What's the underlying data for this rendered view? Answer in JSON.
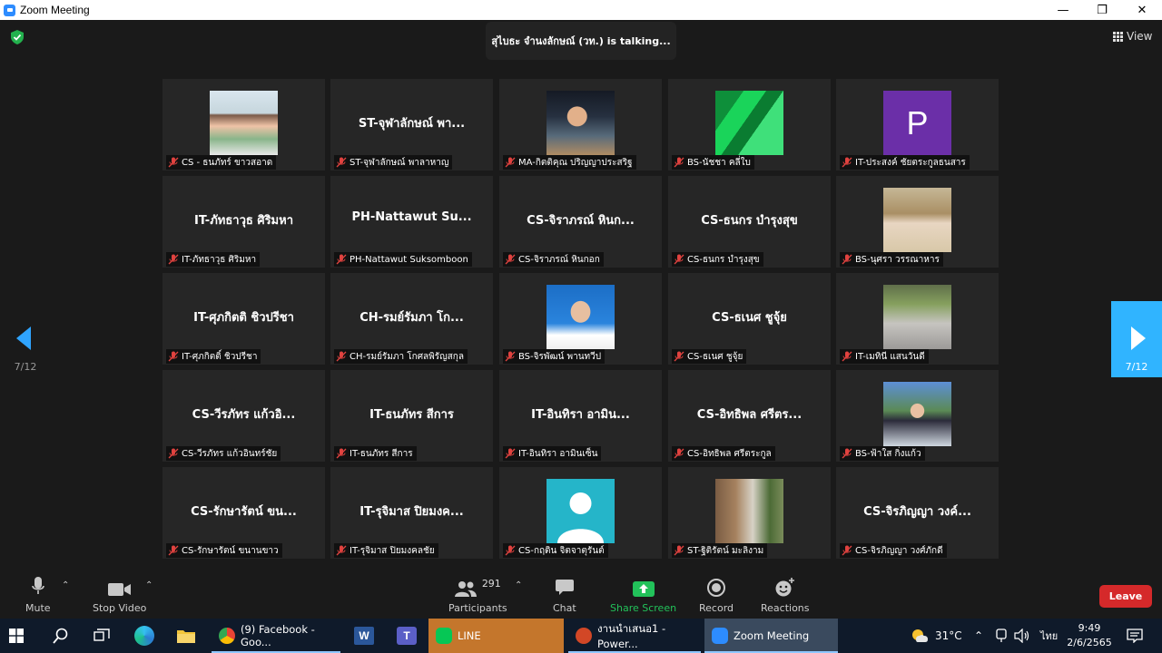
{
  "window": {
    "title": "Zoom Meeting"
  },
  "talking_indicator": "สุไบธะ จำนงลักษณ์ (วท.) is  talking...",
  "view_label": "View",
  "pagination": {
    "left": "7/12",
    "right": "7/12"
  },
  "tiles": [
    {
      "display": "",
      "label": "CS - ธนภัทร์ ขาวสอาด",
      "photo": "photo-person"
    },
    {
      "display": "ST-จุฬาลักษณ์ พา...",
      "label": "ST-จุฬาลักษณ์ พาลาหาญ",
      "photo": ""
    },
    {
      "display": "",
      "label": "MA-กิตติคุณ ปริญญาประสริฐ",
      "photo": "photo-night"
    },
    {
      "display": "",
      "label": "BS-นัชชา คลี่ใบ",
      "photo": "photo-green"
    },
    {
      "display": "",
      "label": "IT-ประสงค์ ชัยตระกูลธนสาร",
      "photo": "letter",
      "letter": "P"
    },
    {
      "display": "IT-ภัทธาวุธ ศิริมหา",
      "label": "IT-ภัทธาวุธ ศิริมหา",
      "photo": ""
    },
    {
      "display": "PH-Nattawut  Su...",
      "label": "PH-Nattawut Suksomboon",
      "photo": ""
    },
    {
      "display": "CS-จิราภรณ์ หินก...",
      "label": "CS-จิราภรณ์ หินกอก",
      "photo": ""
    },
    {
      "display": "CS-ธนกร บำรุงสุข",
      "label": "CS-ธนกร บำรุงสุข",
      "photo": ""
    },
    {
      "display": "",
      "label": "BS-นุศรา วรรณาหาร",
      "photo": "photo-outdoor"
    },
    {
      "display": "IT-ศุภกิตติ ชิวปรีชา",
      "label": "IT-ศุภกิตติ์ ชิวปรีชา",
      "photo": ""
    },
    {
      "display": "CH-รมย์รัมภา โก...",
      "label": "CH-รมย์รัมภา โกศลพิรัญสกุล",
      "photo": ""
    },
    {
      "display": "",
      "label": "BS-จิรพัฒน์ พานทวีป",
      "photo": "photo-portrait"
    },
    {
      "display": "CS-ธเนศ ชูจุ้ย",
      "label": "CS-ธเนศ ชูจุ้ย",
      "photo": ""
    },
    {
      "display": "",
      "label": "IT-เมทินี แสนวันดี",
      "photo": "photo-road"
    },
    {
      "display": "CS-วีรภัทร แก้วอิ...",
      "label": "CS-วีรภัทร แก้วอินทร์ชัย",
      "photo": ""
    },
    {
      "display": "IT-ธนภัทร สีการ",
      "label": "IT-ธนภัทร สีการ",
      "photo": ""
    },
    {
      "display": "IT-อินทิรา อามิน...",
      "label": "IT-อินทิรา อามินเซ็น",
      "photo": ""
    },
    {
      "display": "CS-อิทธิพล ศรีตร...",
      "label": "CS-อิทธิพล ศรีตระกูล",
      "photo": ""
    },
    {
      "display": "",
      "label": "BS-ฟ้าใส กิ่งแก้ว",
      "photo": "photo-flex"
    },
    {
      "display": "CS-รักษารัตน์ ขน...",
      "label": "CS-รักษารัตน์ ขนานขาว",
      "photo": ""
    },
    {
      "display": "IT-รุจิมาส ปิยมงค...",
      "label": "IT-รุจิมาส ปิยมงคลชัย",
      "photo": ""
    },
    {
      "display": "",
      "label": "CS-กฤติน จิตจาตุรันต์",
      "photo": "default"
    },
    {
      "display": "",
      "label": "ST-ฐิติรัตน์ มะลิงาม",
      "photo": "photo-standing"
    },
    {
      "display": "CS-จิรภิญญา วงค์...",
      "label": "CS-จิรภิญญา วงศ์ภักดี",
      "photo": ""
    }
  ],
  "toolbar": {
    "mute": "Mute",
    "stop_video": "Stop Video",
    "participants": "Participants",
    "participants_count": "291",
    "chat": "Chat",
    "share_screen": "Share Screen",
    "record": "Record",
    "reactions": "Reactions",
    "leave": "Leave"
  },
  "taskbar": {
    "facebook": "(9) Facebook - Goo...",
    "line": "LINE",
    "powerpoint": "งานนำเสนอ1 - Power...",
    "zoom": "Zoom Meeting",
    "temperature": "31°C",
    "language": "ไทย",
    "time": "9:49",
    "date": "2/6/2565"
  },
  "colors": {
    "accent": "#2d8cff",
    "share_green": "#22c25a",
    "leave_red": "#d5292a",
    "nav_blue": "#30b4ff",
    "line_orange": "#c4762c"
  }
}
